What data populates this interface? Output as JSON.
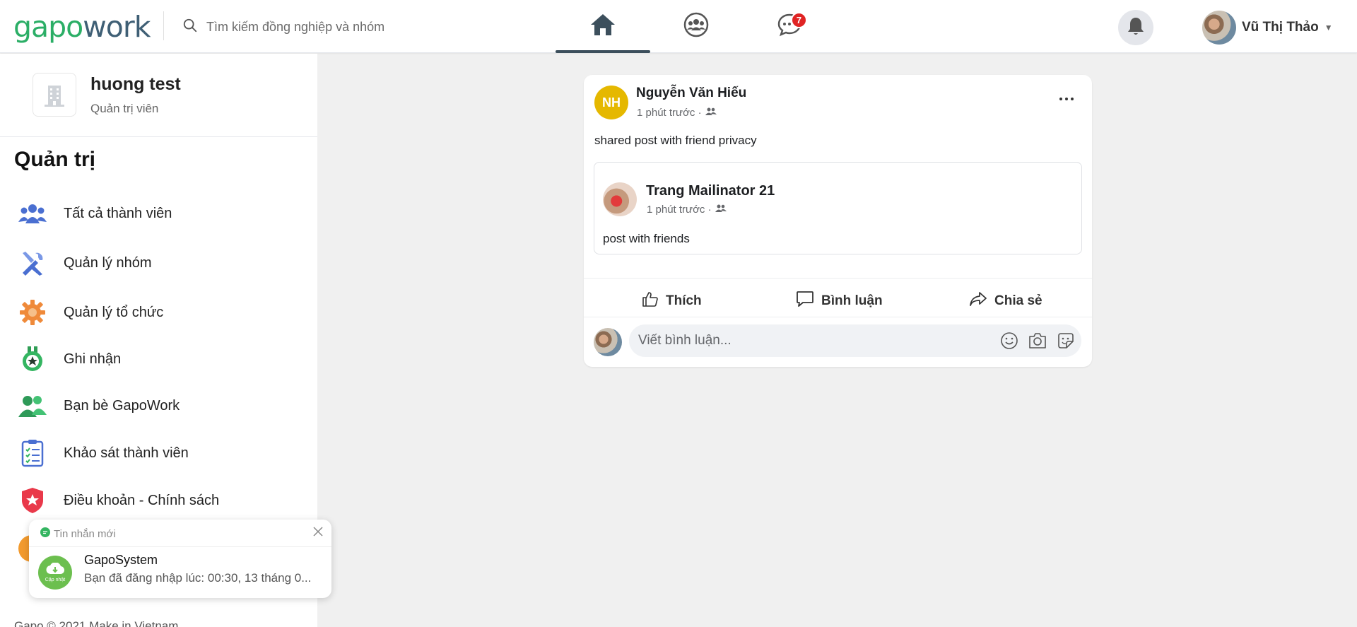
{
  "header": {
    "logo_part1": "gapo",
    "logo_part2": "work",
    "search_placeholder": "Tìm kiếm đồng nghiệp và nhóm",
    "chat_badge": "7",
    "user_name": "Vũ Thị Thảo"
  },
  "sidebar": {
    "org_name": "huong test",
    "org_role": "Quản trị viên",
    "section_title": "Quản trị",
    "items": [
      {
        "label": "Tất cả thành viên",
        "icon": "members-icon"
      },
      {
        "label": "Quản lý nhóm",
        "icon": "tools-icon"
      },
      {
        "label": "Quản lý tổ chức",
        "icon": "gear-icon"
      },
      {
        "label": "Ghi nhận",
        "icon": "medal-icon"
      },
      {
        "label": "Bạn bè GapoWork",
        "icon": "friends-icon"
      },
      {
        "label": "Khảo sát thành viên",
        "icon": "survey-icon"
      },
      {
        "label": "Điều khoản - Chính sách",
        "icon": "shield-icon"
      }
    ],
    "footer": "Gapo © 2021 Make in Vietnam"
  },
  "toast": {
    "header": "Tin nhắn mới",
    "icon_caption": "Cập nhật",
    "title": "GapoSystem",
    "body": "Bạn đã đăng nhập lúc: 00:30, 13 tháng 0..."
  },
  "post": {
    "avatar_initials": "NH",
    "author": "Nguyễn Văn Hiếu",
    "time": "1 phút trước ·",
    "text": "shared post with friend privacy",
    "shared": {
      "author": "Trang Mailinator 21",
      "time": "1 phút trước ·",
      "text": "post with friends"
    },
    "actions": {
      "like": "Thích",
      "comment": "Bình luận",
      "share": "Chia sẻ"
    },
    "comment_placeholder": "Viết bình luận..."
  },
  "colors": {
    "brand_green": "#2bae66",
    "brand_dark": "#3f5f75",
    "badge_red": "#e02424",
    "avatar_yellow": "#e5b800"
  }
}
